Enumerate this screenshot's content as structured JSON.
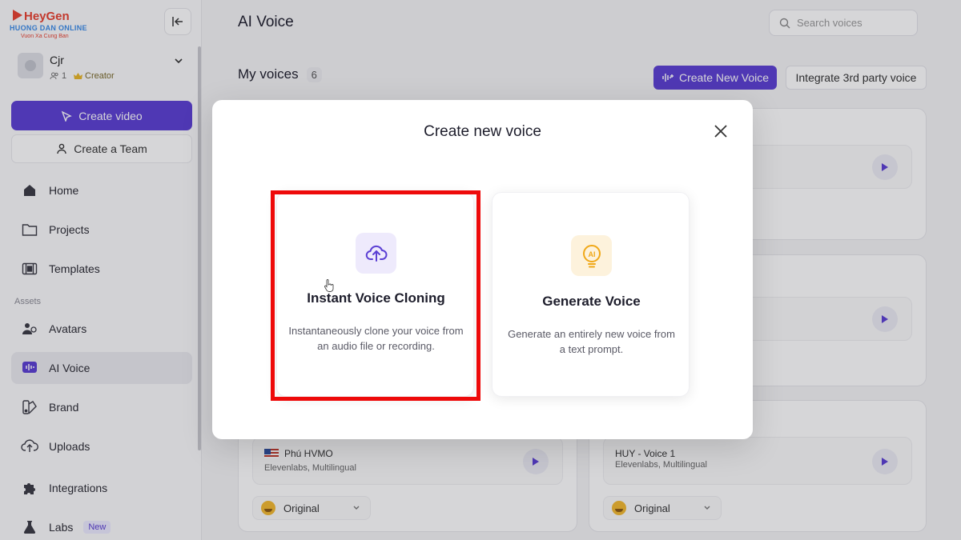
{
  "logo": {
    "name": "HeyGen",
    "sub1": "HUONG DAN ONLINE",
    "sub2": "Vuon Xa Cung Ban"
  },
  "account": {
    "name": "Cjr",
    "members": "1",
    "plan": "Creator"
  },
  "sidebar": {
    "create_video": "Create video",
    "create_team": "Create a Team",
    "assets_label": "Assets",
    "items": [
      {
        "label": "Home",
        "icon": "home-icon"
      },
      {
        "label": "Projects",
        "icon": "folder-icon"
      },
      {
        "label": "Templates",
        "icon": "film-icon"
      },
      {
        "label": "Avatars",
        "icon": "avatars-icon"
      },
      {
        "label": "AI Voice",
        "icon": "voice-icon"
      },
      {
        "label": "Brand",
        "icon": "brand-icon"
      },
      {
        "label": "Uploads",
        "icon": "upload-icon"
      },
      {
        "label": "Integrations",
        "icon": "puzzle-icon"
      },
      {
        "label": "Labs",
        "icon": "flask-icon",
        "badge": "New"
      }
    ]
  },
  "header": {
    "title": "AI Voice",
    "search_placeholder": "Search voices"
  },
  "my_voices": {
    "title": "My voices",
    "count": "6",
    "create_new": "Create New Voice",
    "integrate": "Integrate 3rd party voice"
  },
  "voices": [
    {
      "name": "Phú HVMO",
      "meta": "Elevenlabs, Multilingual",
      "style": "Original",
      "flag": "us"
    },
    {
      "name": "HUY - Voice 1",
      "meta": "Elevenlabs, Multilingual",
      "style": "Original",
      "flag": ""
    }
  ],
  "modal": {
    "title": "Create new voice",
    "options": [
      {
        "title": "Instant Voice Cloning",
        "desc": "Instantaneously clone your voice from an audio file or recording.",
        "icon": "cloud-upload-icon"
      },
      {
        "title": "Generate Voice",
        "desc": "Generate an entirely new voice from a text prompt.",
        "icon": "ai-bulb-icon"
      }
    ]
  },
  "colors": {
    "accent": "#5b3fd4",
    "highlight": "#ee0a0a"
  }
}
